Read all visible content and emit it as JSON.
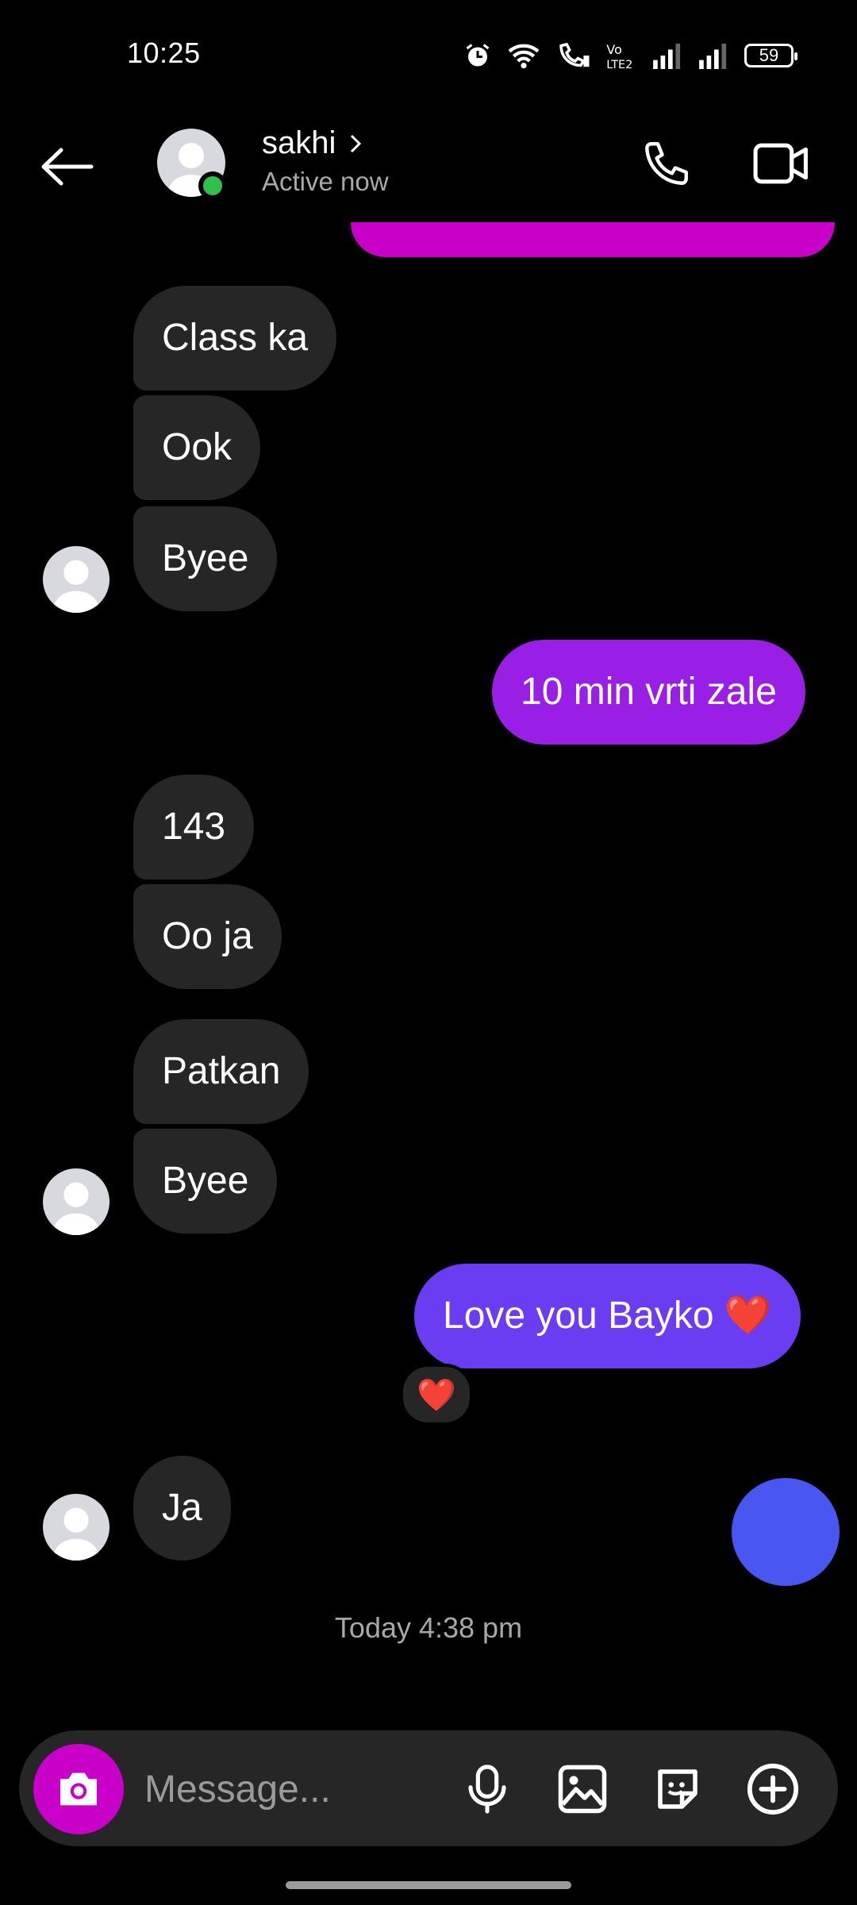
{
  "status_bar": {
    "time": "10:25",
    "battery_level": "59",
    "icons": [
      "alarm-icon",
      "wifi-icon",
      "wifi-calling-icon",
      "volte-icon",
      "signal-icon",
      "signal-icon",
      "battery-icon"
    ]
  },
  "header": {
    "contact_name": "sakhi",
    "contact_status": "Active now",
    "online_color": "#2ec14b"
  },
  "messages": [
    {
      "from": "them",
      "text": "Class ka"
    },
    {
      "from": "them",
      "text": "Ook"
    },
    {
      "from": "them",
      "text": "Byee"
    },
    {
      "from": "me",
      "text": "10 min vrti zale",
      "color": "#9a1fe6"
    },
    {
      "from": "them",
      "text": "143"
    },
    {
      "from": "them",
      "text": "Oo ja"
    },
    {
      "from": "them",
      "text": "Patkan"
    },
    {
      "from": "them",
      "text": "Byee"
    },
    {
      "from": "me",
      "text": "Love you Bayko ❤️",
      "color": "#6a3cf2",
      "reaction": "❤️"
    },
    {
      "from": "them",
      "text": "Ja"
    }
  ],
  "timestamp": "Today 4:38 pm",
  "composer": {
    "placeholder": "Message...",
    "camera_color": "#c800c8"
  }
}
